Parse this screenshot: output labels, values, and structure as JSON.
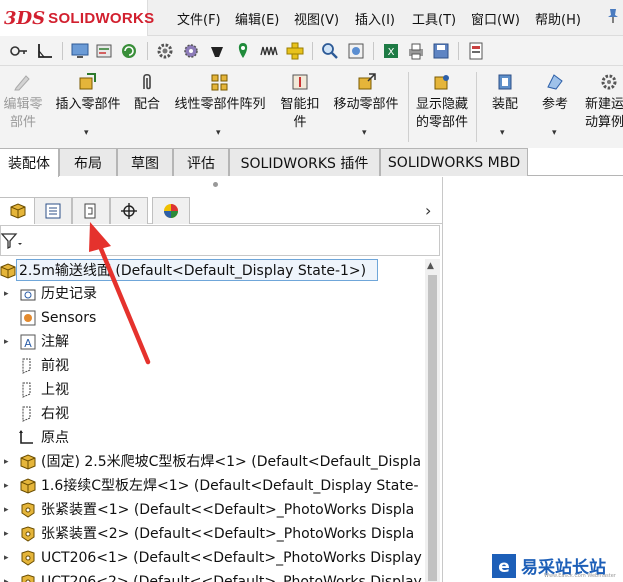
{
  "brand": {
    "logo_mark": "3DS",
    "name": "SOLIDWORKS",
    "color": "#d2202f"
  },
  "menu": {
    "items": [
      "文件(F)",
      "编辑(E)",
      "视图(V)",
      "插入(I)",
      "工具(T)",
      "窗口(W)",
      "帮助(H)"
    ],
    "pin_icon": "pushpin-icon"
  },
  "standard_toolbar": {
    "icons": [
      "key-icon",
      "angle-dimension-icon",
      "monitor-icon",
      "measure-icon",
      "rebuild-icon",
      "gear-icon",
      "settings-cog-icon",
      "lamp-icon",
      "location-pin-icon",
      "waveform-icon",
      "crossbar-icon",
      "zoom-icon",
      "appearance-icon",
      "excel-icon",
      "print-icon",
      "save-icon",
      "options-icon"
    ]
  },
  "command_manager": {
    "buttons": [
      {
        "label": "编辑零\n部件",
        "icon": "edit-component-icon",
        "enabled": false
      },
      {
        "label": "插入零部件",
        "icon": "insert-components-icon",
        "enabled": true
      },
      {
        "label": "配合",
        "icon": "mate-paperclip-icon",
        "enabled": true
      },
      {
        "label": "线性零部件阵列",
        "icon": "linear-pattern-icon",
        "enabled": true
      },
      {
        "label": "智能扣\n件",
        "icon": "smart-fasteners-icon",
        "enabled": true
      },
      {
        "label": "移动零部件",
        "icon": "move-component-icon",
        "enabled": true
      },
      {
        "label": "显示隐藏\n的零部件",
        "icon": "show-hidden-icon",
        "enabled": true
      },
      {
        "label": "装配",
        "icon": "assembly-features-icon",
        "enabled": true
      },
      {
        "label": "参考",
        "icon": "reference-geometry-icon",
        "enabled": true
      },
      {
        "label": "新建运\n动算例",
        "icon": "new-motion-study-icon",
        "enabled": true
      }
    ]
  },
  "tabs": [
    "装配体",
    "布局",
    "草图",
    "评估",
    "SOLIDWORKS 插件",
    "SOLIDWORKS MBD"
  ],
  "active_tab": "装配体",
  "panel_tabs": [
    "feature-manager-icon",
    "property-manager-icon",
    "configuration-manager-icon",
    "dimxpert-icon",
    "display-manager-icon"
  ],
  "tree": {
    "root": "2.5m输送线面  (Default<Default_Display State-1>)",
    "items": [
      {
        "label": "历史记录",
        "icon": "history-folder-icon",
        "expandable": true
      },
      {
        "label": "Sensors",
        "icon": "sensor-icon",
        "expandable": false
      },
      {
        "label": "注解",
        "icon": "annotations-icon",
        "expandable": true
      },
      {
        "label": "前视",
        "icon": "plane-icon",
        "expandable": false
      },
      {
        "label": "上视",
        "icon": "plane-icon",
        "expandable": false
      },
      {
        "label": "右视",
        "icon": "plane-icon",
        "expandable": false
      },
      {
        "label": "原点",
        "icon": "origin-icon",
        "expandable": false
      },
      {
        "label": "(固定) 2.5米爬坡C型板右焊<1> (Default<Default_Displa",
        "icon": "part-icon",
        "expandable": true
      },
      {
        "label": "1.6接续C型板左焊<1> (Default<Default_Display State-",
        "icon": "part-icon",
        "expandable": true
      },
      {
        "label": "张紧装置<1> (Default<<Default>_PhotoWorks Displa",
        "icon": "subassembly-icon",
        "expandable": true
      },
      {
        "label": "张紧装置<2> (Default<<Default>_PhotoWorks Displa",
        "icon": "subassembly-icon",
        "expandable": true
      },
      {
        "label": "UCT206<1> (Default<<Default>_PhotoWorks Display",
        "icon": "subassembly-icon",
        "expandable": true
      },
      {
        "label": "UCT206<2> (Default<<Default>_PhotoWorks Display",
        "icon": "subassembly-icon",
        "expandable": true
      }
    ]
  },
  "watermark": {
    "text": "易采站长站",
    "sub": "Www.Easck.Com Webmaster"
  }
}
